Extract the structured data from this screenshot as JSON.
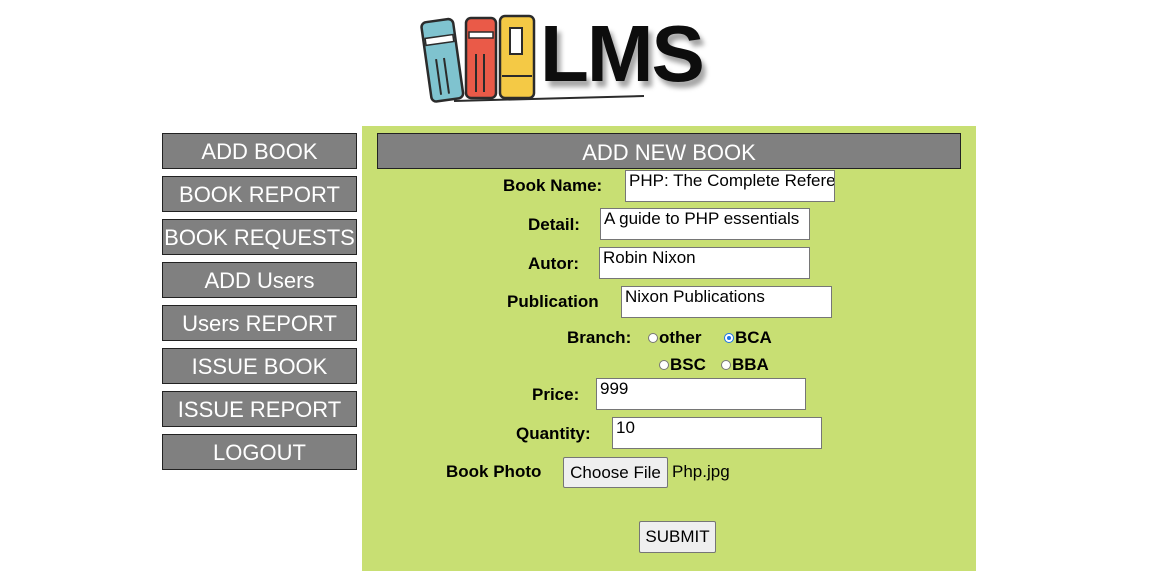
{
  "logo": {
    "text": "LMS"
  },
  "sidebar": {
    "items": [
      {
        "label": "ADD BOOK"
      },
      {
        "label": "BOOK REPORT"
      },
      {
        "label": "BOOK REQUESTS"
      },
      {
        "label": "ADD Users"
      },
      {
        "label": "Users REPORT"
      },
      {
        "label": "ISSUE BOOK"
      },
      {
        "label": "ISSUE REPORT"
      },
      {
        "label": "LOGOUT"
      }
    ]
  },
  "form": {
    "title": "ADD NEW BOOK",
    "book_name": {
      "label": "Book Name:",
      "value": "PHP: The Complete Refere"
    },
    "detail": {
      "label": "Detail:",
      "value": "A guide to PHP essentials"
    },
    "author": {
      "label": "Autor:",
      "value": "Robin Nixon"
    },
    "publication": {
      "label": "Publication",
      "value": "Nixon Publications"
    },
    "branch": {
      "label": "Branch:",
      "options": [
        "other",
        "BCA",
        "BSC",
        "BBA"
      ],
      "selected": "BCA"
    },
    "price": {
      "label": "Price:",
      "value": "999"
    },
    "quantity": {
      "label": "Quantity:",
      "value": "10"
    },
    "photo": {
      "label": "Book Photo",
      "button": "Choose File",
      "file_name": "Php.jpg"
    },
    "submit": "SUBMIT"
  },
  "colors": {
    "panel_bg": "#c8df73",
    "button_bg": "#808080",
    "radio_accent": "#1a73e8"
  }
}
